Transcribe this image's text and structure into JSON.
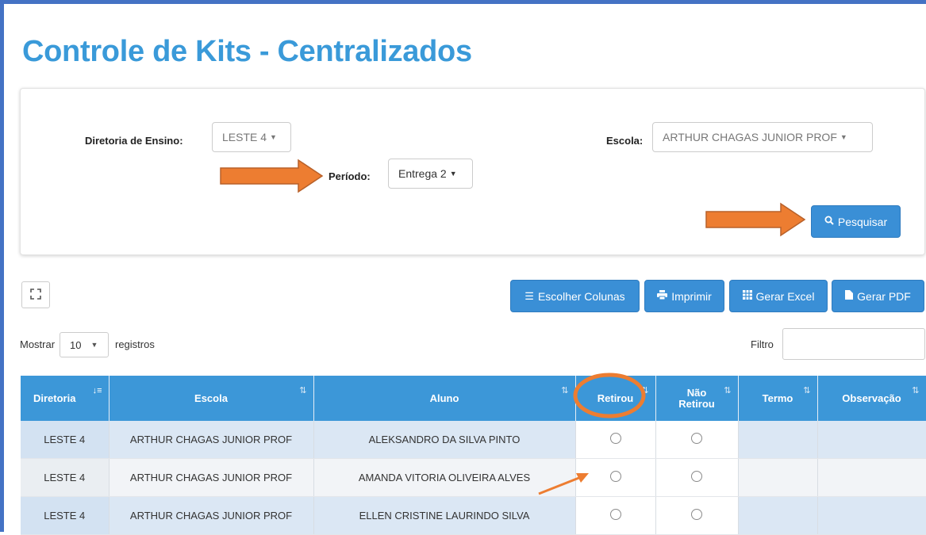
{
  "title": "Controle de Kits - Centralizados",
  "filters": {
    "diretoria_label": "Diretoria de Ensino:",
    "diretoria_value": "LESTE 4",
    "escola_label": "Escola:",
    "escola_value": "ARTHUR CHAGAS JUNIOR PROF",
    "periodo_label": "Período:",
    "periodo_value": "Entrega 2",
    "search_button": "Pesquisar"
  },
  "toolbar": {
    "choose_columns": "Escolher Colunas",
    "print": "Imprimir",
    "excel": "Gerar Excel",
    "pdf": "Gerar PDF"
  },
  "length": {
    "show_label": "Mostrar",
    "value": "10",
    "records_label": "registros"
  },
  "filter": {
    "label": "Filtro",
    "value": ""
  },
  "table": {
    "columns": [
      "Diretoria",
      "Escola",
      "Aluno",
      "Retirou",
      "Não Retirou",
      "Termo",
      "Observação"
    ],
    "rows": [
      [
        "LESTE 4",
        "ARTHUR CHAGAS JUNIOR PROF",
        "ALEKSANDRO DA SILVA PINTO"
      ],
      [
        "LESTE 4",
        "ARTHUR CHAGAS JUNIOR PROF",
        "AMANDA VITORIA OLIVEIRA ALVES"
      ],
      [
        "LESTE 4",
        "ARTHUR CHAGAS JUNIOR PROF",
        "ELLEN CRISTINE LAURINDO SILVA"
      ]
    ]
  },
  "colors": {
    "accent": "#3a8fd6",
    "title": "#3a9ad9",
    "annotation": "#ed7d31",
    "header": "#3c97d8"
  },
  "icons": [
    "expand-icon",
    "list-icon",
    "print-icon",
    "grid-icon",
    "file-icon",
    "search-icon",
    "sort-icon"
  ]
}
